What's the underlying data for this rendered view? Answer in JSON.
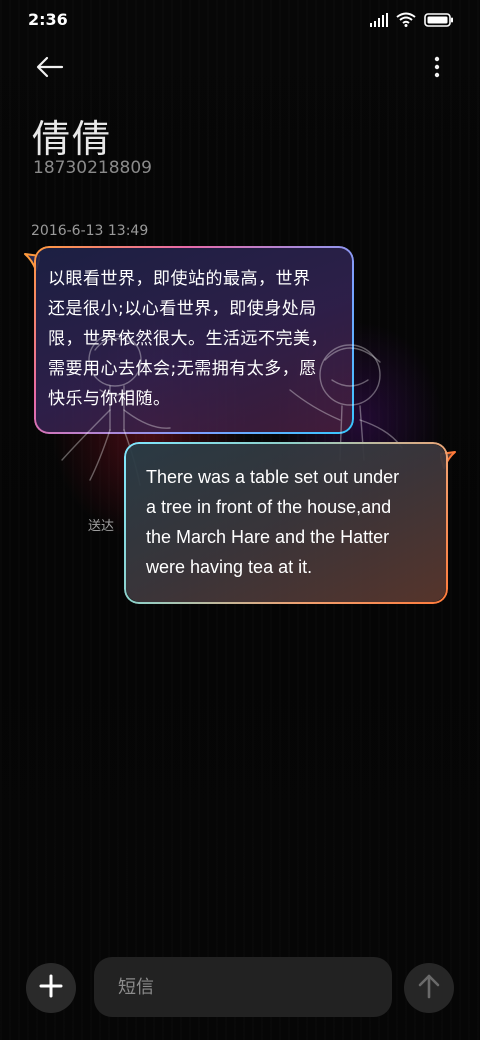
{
  "status_bar": {
    "time": "2:36",
    "icons": [
      "signal-icon",
      "wifi-icon",
      "battery-icon"
    ]
  },
  "header": {
    "back_icon": "back-arrow-icon",
    "more_icon": "more-vertical-icon",
    "contact_name": "倩倩",
    "contact_number": "18730218809"
  },
  "conversation": {
    "timestamp": "2016-6-13 13:49",
    "incoming_message": {
      "lines": [
        "以眼看世界，即使站的最高，世界",
        "还是很小;以心看世界，即使身处局",
        "限，世界依然很大。生活远不完美，",
        "需要用心去体会;无需拥有太多，愿",
        "快乐与你相随。"
      ]
    },
    "outgoing_message": {
      "lines": [
        "There was a table set out under",
        "a tree in front of the house,and",
        "the March Hare and the Hatter",
        "were having tea at it."
      ]
    },
    "delivery_status": "送达"
  },
  "composer": {
    "add_icon": "plus-icon",
    "placeholder": "短信",
    "value": "",
    "send_icon": "send-arrow-up-icon"
  },
  "colors": {
    "background": "#050505",
    "incoming_border_start": "#ff9a3c",
    "incoming_border_end": "#35c8ff",
    "outgoing_border_start": "#7de7ff",
    "outgoing_border_end": "#ff7a3a"
  }
}
